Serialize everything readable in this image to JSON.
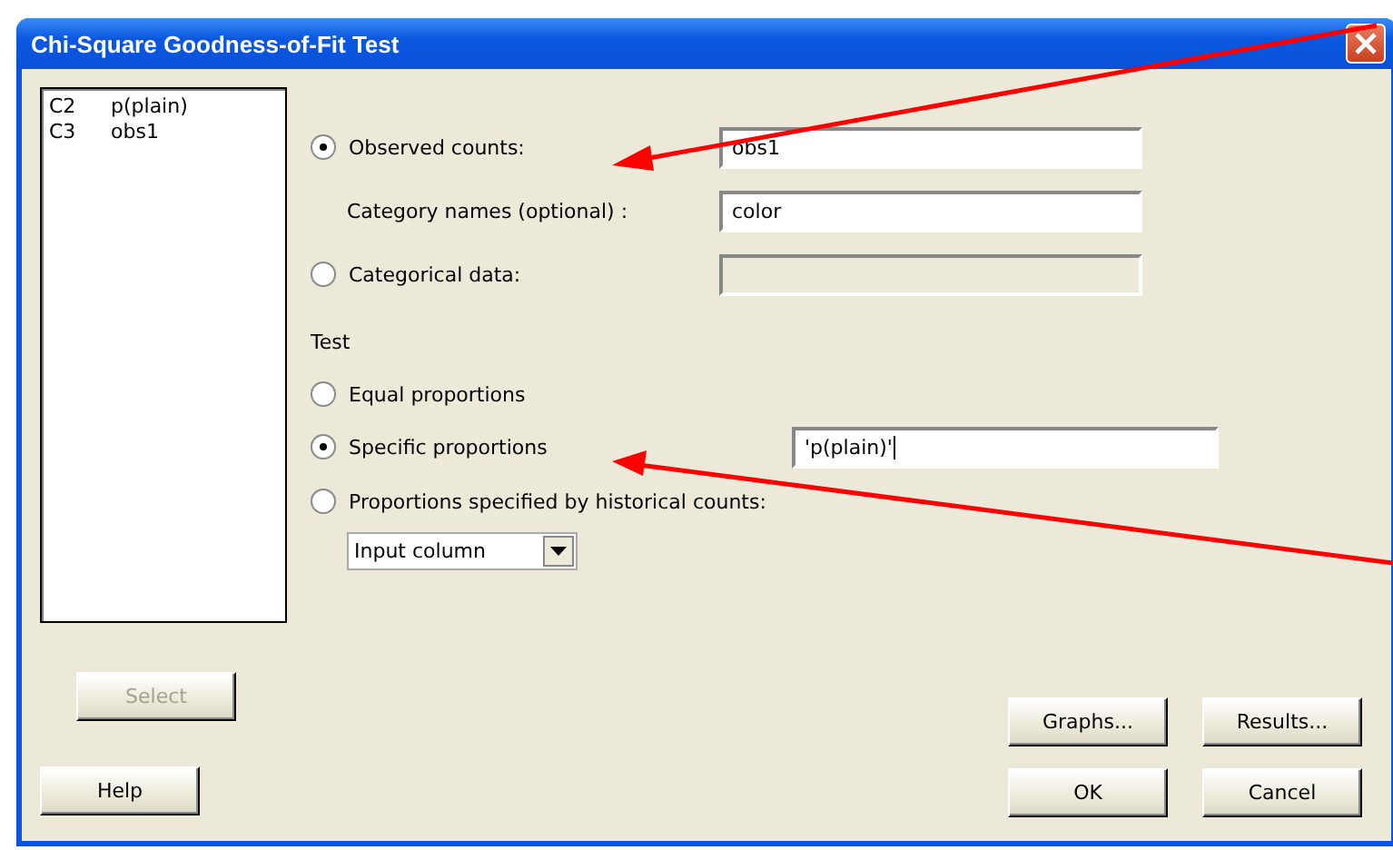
{
  "window": {
    "title": "Chi-Square Goodness-of-Fit Test"
  },
  "variables": [
    {
      "column": "C2",
      "name": "p(plain)"
    },
    {
      "column": "C3",
      "name": "obs1"
    }
  ],
  "data_source": [
    {
      "kind": "radio",
      "label": "Observed counts:",
      "selected": true,
      "value": "obs1",
      "disabled": false
    },
    {
      "kind": "plain",
      "label": "Category names (optional) :",
      "value": "color",
      "disabled": false
    },
    {
      "kind": "radio",
      "label": "Categorical data:",
      "selected": false,
      "disabled": true
    }
  ],
  "test": {
    "label": "Test",
    "options": [
      {
        "label": "Equal proportions",
        "selected": false
      },
      {
        "label": "Specific proportions",
        "selected": true,
        "value": "'p(plain)'"
      },
      {
        "label": "Proportions specified by historical counts:",
        "selected": false,
        "dropdown": "Input column"
      }
    ]
  },
  "buttons": [
    {
      "label": "Select",
      "disabled": true
    },
    {
      "label": "Help",
      "disabled": false
    },
    {
      "label": "Graphs...",
      "disabled": false
    },
    {
      "label": "Results...",
      "disabled": false
    },
    {
      "label": "OK",
      "disabled": false
    },
    {
      "label": "Cancel",
      "disabled": false
    }
  ]
}
